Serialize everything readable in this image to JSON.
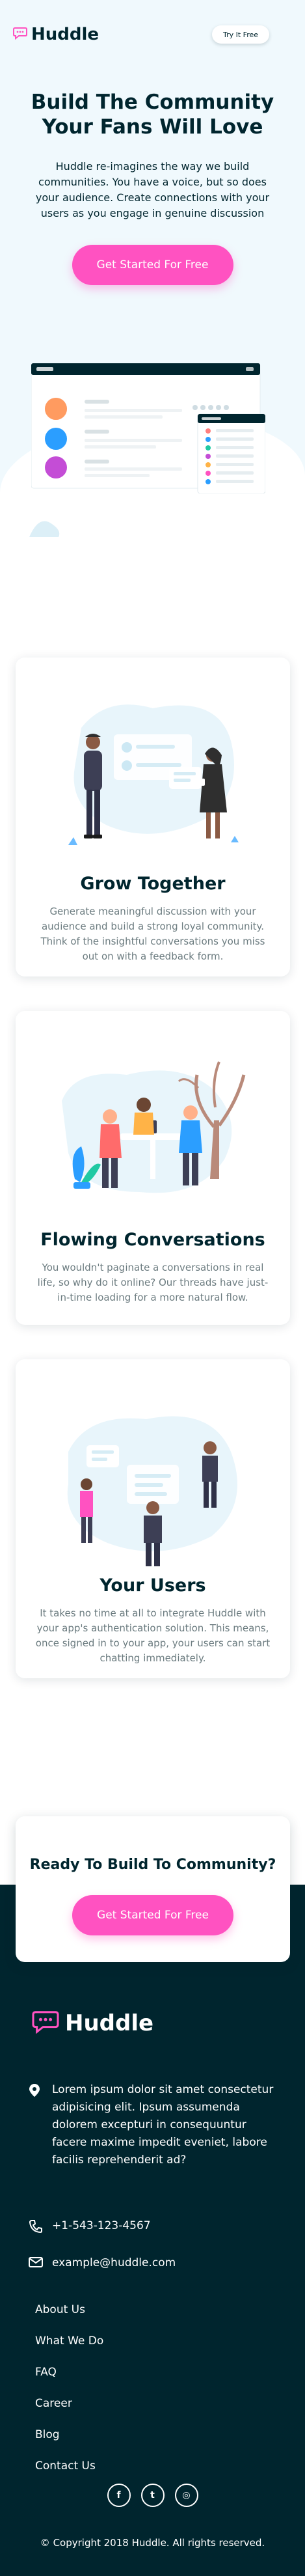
{
  "header": {
    "logo_text": "Huddle",
    "try_button": "Try It Free"
  },
  "hero": {
    "title": "Build The Community Your Fans Will Love",
    "text": "Huddle re-imagines the way we build communities. You have a voice, but so does your audience. Create connections with your users as you engage in genuine discussion",
    "cta": "Get Started For Free"
  },
  "features": [
    {
      "title": "Grow Together",
      "text": "Generate meaningful discussion with your audience and build a strong loyal community. Think of the insightful conversations you miss out on with a feedback form."
    },
    {
      "title": "Flowing Conversations",
      "text": "You wouldn't paginate a conversations in real life, so why do it online? Our threads have just-in-time loading for a more natural flow."
    },
    {
      "title": "Your Users",
      "text": "It takes no time at all to integrate Huddle with your app's authentication solution. This means, once signed in to your app, your users can start chatting immediately."
    }
  ],
  "ready": {
    "title": "Ready To Build To Community?",
    "cta": "Get Started For Free"
  },
  "footer": {
    "logo_text": "Huddle",
    "address": "Lorem ipsum dolor sit amet consectetur adipisicing elit. Ipsum assumenda dolorem excepturi in consequuntur facere maxime impedit eveniet, labore facilis reprehenderit ad?",
    "phone": "+1-543-123-4567",
    "email": "example@huddle.com",
    "links": [
      "About Us",
      "What We Do",
      "FAQ",
      "Career",
      "Blog",
      "Contact Us"
    ],
    "socials": [
      {
        "icon": "facebook-icon",
        "glyph": "f"
      },
      {
        "icon": "twitter-icon",
        "glyph": "t"
      },
      {
        "icon": "instagram-icon",
        "glyph": "◎"
      }
    ],
    "copyright": "© Copyright 2018 Huddle. All rights reserved."
  },
  "colors": {
    "pink": "#ff52c1",
    "dark_cyan": "#00252e",
    "light_blue": "#f0f9fd",
    "grey_text": "#6c7c80"
  }
}
